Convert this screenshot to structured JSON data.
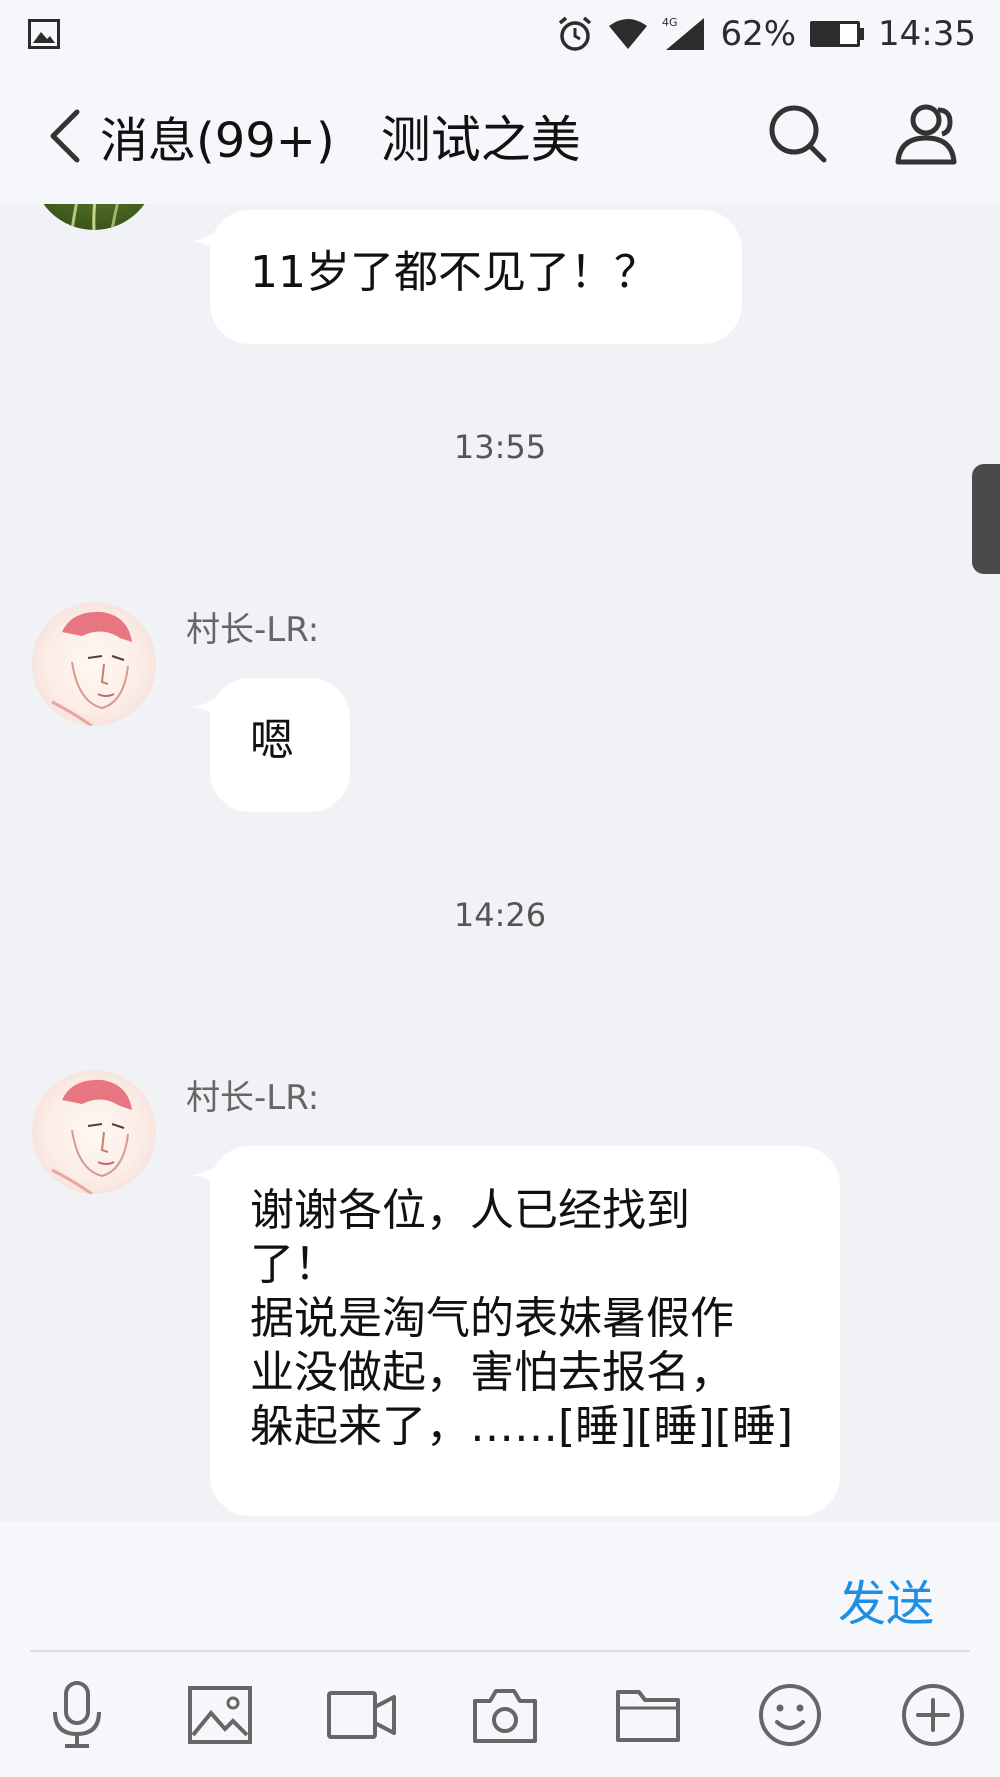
{
  "status_bar": {
    "network": "4G",
    "battery": "62%",
    "time": "14:35"
  },
  "header": {
    "back_label": "消息(99+)",
    "title": "测试之美"
  },
  "messages": [
    {
      "text": "11岁了都不见了！？"
    },
    {
      "timestamp": "13:55"
    },
    {
      "sender": "村长-LR:",
      "text": "嗯"
    },
    {
      "timestamp": "14:26"
    },
    {
      "sender": "村长-LR:",
      "lines": [
        "谢谢各位，人已经找到",
        "了！",
        "据说是淘气的表妹暑假作",
        "业没做起，害怕去报名，",
        "躲起来了，……[睡][睡][睡]"
      ]
    }
  ],
  "input": {
    "placeholder": "",
    "send_label": "发送"
  },
  "toolbar": {
    "icons": [
      "microphone-icon",
      "image-icon",
      "video-icon",
      "camera-icon",
      "folder-icon",
      "emoji-icon",
      "plus-icon"
    ]
  },
  "colors": {
    "background": "#f1f2f6",
    "bubble": "#ffffff",
    "accent": "#1f8fe5"
  }
}
